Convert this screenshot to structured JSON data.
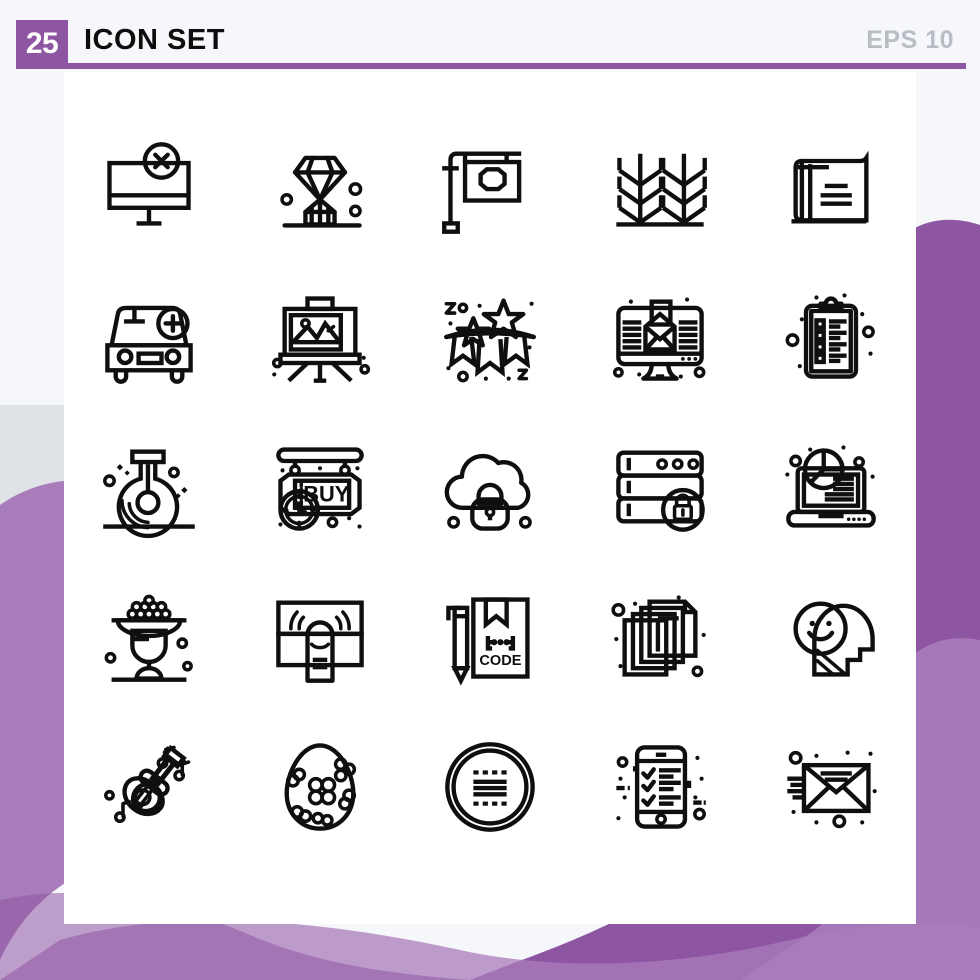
{
  "header": {
    "count_badge": "25",
    "title": "ICON SET",
    "eps_label": "EPS 10",
    "badge_color": "#8e55a2",
    "rule_color": "#8e55a2",
    "title_color": "#0d0d0d",
    "eps_color": "#b9bcc4"
  },
  "canvas": {
    "background_color": "#f6f7fa",
    "card_color": "#ffffff",
    "blob_color_dark": "#8e55a2",
    "blob_color_light": "#a87cbb",
    "blob_color_grey": "#dfe3e8",
    "stroke_color": "#100f0d"
  },
  "grid": {
    "columns": 5,
    "rows": 5,
    "total_icons": 25
  },
  "icons": [
    {
      "index": 1,
      "name": "monitor-error-icon",
      "label": "Monitor with error cross"
    },
    {
      "index": 2,
      "name": "diamond-ring-icon",
      "label": "Diamond gem"
    },
    {
      "index": 3,
      "name": "signboard-post-icon",
      "label": "Hanging street sign"
    },
    {
      "index": 4,
      "name": "wheat-crops-icon",
      "label": "Wheat crops"
    },
    {
      "index": 5,
      "name": "book-icon",
      "label": "Closed book"
    },
    {
      "index": 6,
      "name": "add-car-icon",
      "label": "Car with plus"
    },
    {
      "index": 7,
      "name": "easel-painting-icon",
      "label": "Easel with landscape painting"
    },
    {
      "index": 8,
      "name": "party-bunting-icon",
      "label": "Party bunting with stars"
    },
    {
      "index": 9,
      "name": "email-monitor-icon",
      "label": "Monitor with envelope"
    },
    {
      "index": 10,
      "name": "clipboard-checklist-icon",
      "label": "Clipboard checklist"
    },
    {
      "index": 11,
      "name": "flask-icon",
      "label": "Round laboratory flask"
    },
    {
      "index": 12,
      "name": "buy-signboard-icon",
      "label": "BUY shop sign with clock"
    },
    {
      "index": 13,
      "name": "cloud-lock-icon",
      "label": "Cloud with padlock"
    },
    {
      "index": 14,
      "name": "server-lock-icon",
      "label": "Server rack with padlock"
    },
    {
      "index": 15,
      "name": "laptop-analytics-icon",
      "label": "Laptop with pie chart report"
    },
    {
      "index": 16,
      "name": "fruit-bowl-icon",
      "label": "Pedestal bowl of fruit"
    },
    {
      "index": 17,
      "name": "tap-gesture-icon",
      "label": "Finger tap gesture"
    },
    {
      "index": 18,
      "name": "code-file-pencil-icon",
      "label": "Code document with pencil"
    },
    {
      "index": 19,
      "name": "documents-stack-icon",
      "label": "Stack of documents"
    },
    {
      "index": 20,
      "name": "positive-mind-icon",
      "label": "Head with smiley face"
    },
    {
      "index": 21,
      "name": "acoustic-guitar-icon",
      "label": "Guitar with music notes"
    },
    {
      "index": 22,
      "name": "easter-egg-icon",
      "label": "Decorated easter egg"
    },
    {
      "index": 23,
      "name": "coin-text-icon",
      "label": "Round badge with text lines"
    },
    {
      "index": 24,
      "name": "mobile-checklist-icon",
      "label": "Smartphone checklist"
    },
    {
      "index": 25,
      "name": "envelope-mail-icon",
      "label": "Envelope mail with motion lines"
    }
  ],
  "icon_text": {
    "buy_sign": "BUY",
    "code_file": "CODE"
  }
}
